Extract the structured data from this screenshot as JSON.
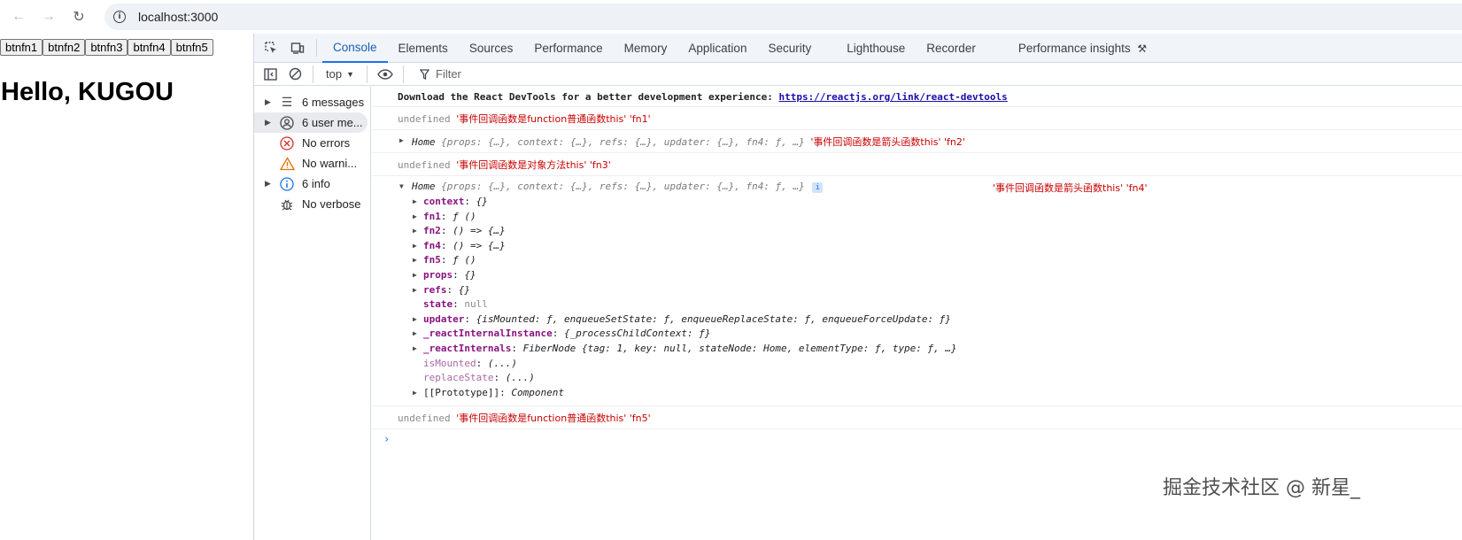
{
  "browser": {
    "url": "localhost:3000"
  },
  "page": {
    "buttons": [
      "btnfn1",
      "btnfn2",
      "btnfn3",
      "btnfn4",
      "btnfn5"
    ],
    "title": "Hello, KUGOU"
  },
  "devtools": {
    "tabs": [
      "Console",
      "Elements",
      "Sources",
      "Performance",
      "Memory",
      "Application",
      "Security",
      "Lighthouse",
      "Recorder",
      "Performance insights"
    ],
    "toolbar": {
      "context": "top",
      "filter_placeholder": "Filter"
    },
    "sidebar": [
      {
        "label": "6 messages",
        "icon": "list-icon",
        "expandable": true
      },
      {
        "label": "6 user me...",
        "icon": "user-icon",
        "expandable": true
      },
      {
        "label": "No errors",
        "icon": "error-icon",
        "expandable": false
      },
      {
        "label": "No warni...",
        "icon": "warning-icon",
        "expandable": false
      },
      {
        "label": "6 info",
        "icon": "info-icon",
        "expandable": true
      },
      {
        "label": "No verbose",
        "icon": "bug-icon",
        "expandable": false
      }
    ]
  },
  "console": {
    "devtools_msg": "Download the React DevTools for a better development experience: ",
    "devtools_link": "https://reactjs.org/link/react-devtools",
    "undefined": "undefined",
    "line1_str": "'事件回调函数是function普通函数this' 'fn1'",
    "line2_obj_name": "Home",
    "line2_obj_summary": "{props: {…}, context: {…}, refs: {…}, updater: {…}, fn4: ƒ,  …}",
    "line2_str": "'事件回调函数是箭头函数this' 'fn2'",
    "line3_str": "'事件回调函数是对象方法this' 'fn3'",
    "line4_obj_name": "Home",
    "line4_obj_summary": "{props: {…}, context: {…}, refs: {…}, updater: {…}, fn4: ƒ,  …}",
    "line4_badge": "i",
    "line4_str": "'事件回调函数是箭头函数this' 'fn4'",
    "props": [
      {
        "key": "context",
        "sep": ": ",
        "value": "{}",
        "expandable": true,
        "style": "key"
      },
      {
        "key": "fn1",
        "sep": ": ",
        "value": "ƒ ()",
        "expandable": true,
        "style": "key"
      },
      {
        "key": "fn2",
        "sep": ": ",
        "value": "() => {…}",
        "expandable": true,
        "style": "key"
      },
      {
        "key": "fn4",
        "sep": ": ",
        "value": "() => {…}",
        "expandable": true,
        "style": "key"
      },
      {
        "key": "fn5",
        "sep": ": ",
        "value": "ƒ ()",
        "expandable": true,
        "style": "key"
      },
      {
        "key": "props",
        "sep": ": ",
        "value": "{}",
        "expandable": true,
        "style": "key"
      },
      {
        "key": "refs",
        "sep": ": ",
        "value": "{}",
        "expandable": true,
        "style": "key"
      },
      {
        "key": "state",
        "sep": ": ",
        "value": "null",
        "expandable": false,
        "style": "key"
      },
      {
        "key": "updater",
        "sep": ": ",
        "value": "{isMounted: ƒ, enqueueSetState: ƒ, enqueueReplaceState: ƒ, enqueueForceUpdate: ƒ}",
        "expandable": true,
        "style": "key"
      },
      {
        "key": "_reactInternalInstance",
        "sep": ": ",
        "value": "{_processChildContext: ƒ}",
        "expandable": true,
        "style": "key"
      },
      {
        "key": "_reactInternals",
        "sep": ": ",
        "value": "FiberNode  {tag: 1, key: null, stateNode: Home, elementType: ƒ, type: ƒ,  …}",
        "expandable": true,
        "style": "key"
      },
      {
        "key": "isMounted",
        "sep": ": ",
        "value": "(...)",
        "expandable": false,
        "style": "dim"
      },
      {
        "key": "replaceState",
        "sep": ": ",
        "value": "(...)",
        "expandable": false,
        "style": "dim"
      },
      {
        "key": "[[Prototype]]",
        "sep": ": ",
        "value": "Component",
        "expandable": true,
        "style": "plain"
      }
    ],
    "line5_str": "'事件回调函数是function普通函数this' 'fn5'",
    "prompt": "›"
  },
  "watermark": "掘金技术社区 @ 新星_"
}
